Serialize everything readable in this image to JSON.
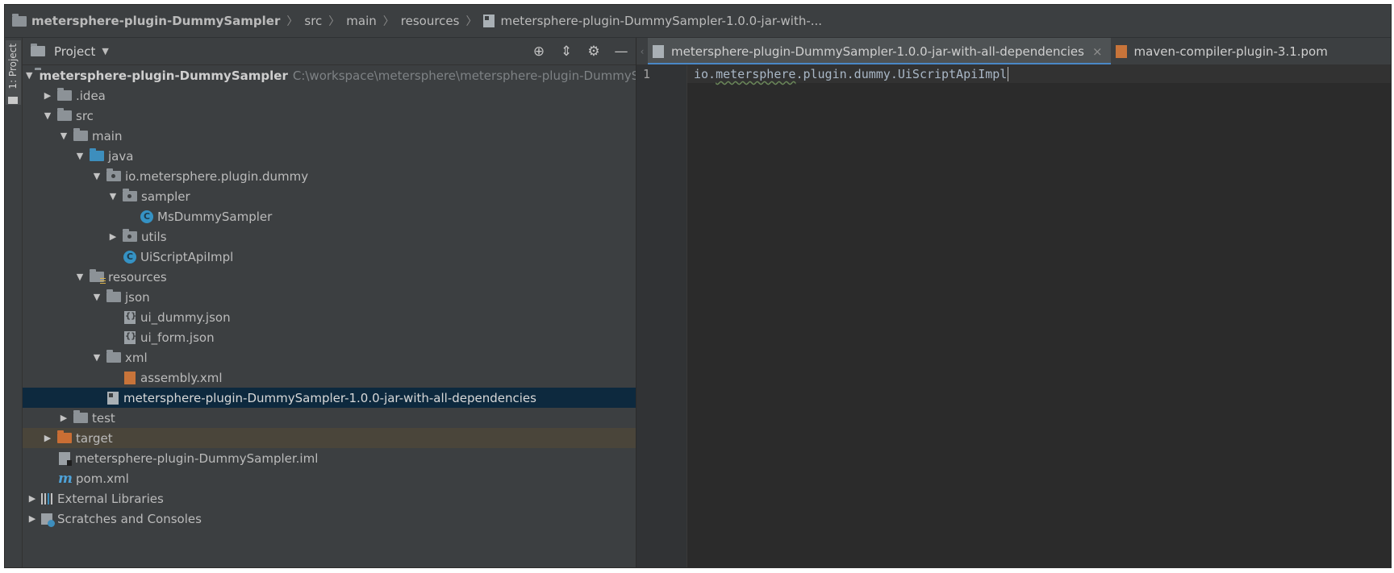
{
  "navbar": {
    "crumbs": [
      "metersphere-plugin-DummySampler",
      "src",
      "main",
      "resources",
      "metersphere-plugin-DummySampler-1.0.0-jar-with-..."
    ]
  },
  "toolwindow": {
    "side_tab": "1: Project",
    "title": "Project",
    "icons": [
      "locate-icon",
      "collapse-all-icon",
      "gear-icon",
      "minimize-icon"
    ]
  },
  "tree": {
    "root": {
      "name": "metersphere-plugin-DummySampler",
      "path": "C:\\workspace\\metersphere\\metersphere-plugin-DummySampler"
    },
    "idea": ".idea",
    "src": "src",
    "main": "main",
    "java": "java",
    "pkg": "io.metersphere.plugin.dummy",
    "sampler": "sampler",
    "ms_dummy": "MsDummySampler",
    "utils": "utils",
    "ui_script": "UiScriptApiImpl",
    "resources": "resources",
    "json": "json",
    "ui_dummy": "ui_dummy.json",
    "ui_form": "ui_form.json",
    "xml": "xml",
    "assembly": "assembly.xml",
    "jarfile": "metersphere-plugin-DummySampler-1.0.0-jar-with-all-dependencies",
    "test": "test",
    "target": "target",
    "iml": "metersphere-plugin-DummySampler.iml",
    "pom": "pom.xml",
    "libs": "External Libraries",
    "scratches": "Scratches and Consoles"
  },
  "editor": {
    "tabs": [
      {
        "label": "metersphere-plugin-DummySampler-1.0.0-jar-with-all-dependencies",
        "active": true
      },
      {
        "label": "maven-compiler-plugin-3.1.pom",
        "active": false
      }
    ],
    "line_number": "1",
    "code": {
      "pre": "io.",
      "wavy": "metersphere",
      "post": ".plugin.dummy.UiScriptApiImpl"
    }
  }
}
